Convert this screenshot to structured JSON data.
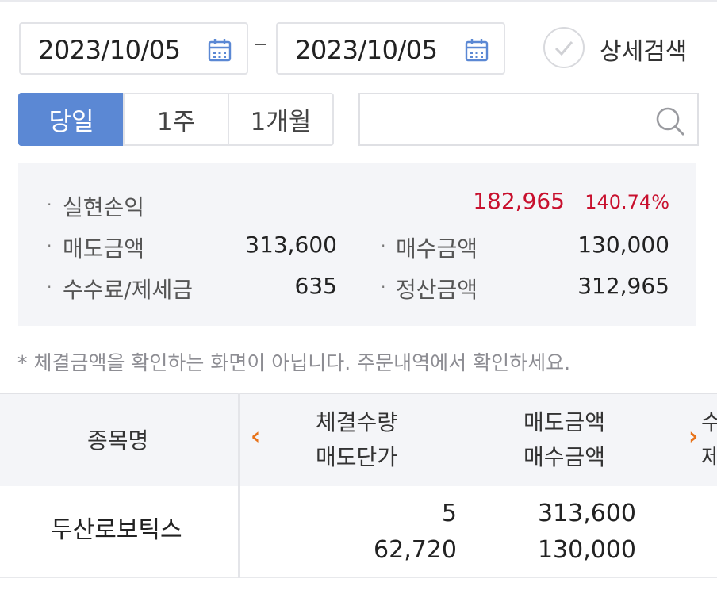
{
  "date_range": {
    "from": "2023/10/05",
    "to": "2023/10/05",
    "separator": "-"
  },
  "detail_search": {
    "label": "상세검색",
    "checked": false
  },
  "period_tabs": [
    {
      "label": "당일",
      "active": true
    },
    {
      "label": "1주",
      "active": false
    },
    {
      "label": "1개월",
      "active": false
    }
  ],
  "search": {
    "value": "",
    "placeholder": ""
  },
  "summary": {
    "realized_pnl": {
      "label": "실현손익",
      "value": "182,965",
      "rate": "140.74%"
    },
    "sell_amount": {
      "label": "매도금액",
      "value": "313,600"
    },
    "buy_amount": {
      "label": "매수금액",
      "value": "130,000"
    },
    "fee_tax": {
      "label": "수수료/제세금",
      "value": "635"
    },
    "settlement": {
      "label": "정산금액",
      "value": "312,965"
    },
    "bullet": "·"
  },
  "note": "* 체결금액을 확인하는 화면이 아닙니다. 주문내역에서 확인하세요.",
  "table": {
    "headers": {
      "name": "종목명",
      "col1_top": "체결수량",
      "col1_bottom": "매도단가",
      "col2_top": "매도금액",
      "col2_bottom": "매수금액",
      "col3_top": "수",
      "col3_bottom": "제"
    },
    "rows": [
      {
        "name": "두산로보틱스",
        "qty": "5",
        "sell_price": "62,720",
        "sell_amount": "313,600",
        "buy_amount": "130,000"
      }
    ]
  },
  "colors": {
    "accent": "#5b88d4",
    "profit_red": "#c8102e",
    "arrow_orange": "#e8731a"
  }
}
